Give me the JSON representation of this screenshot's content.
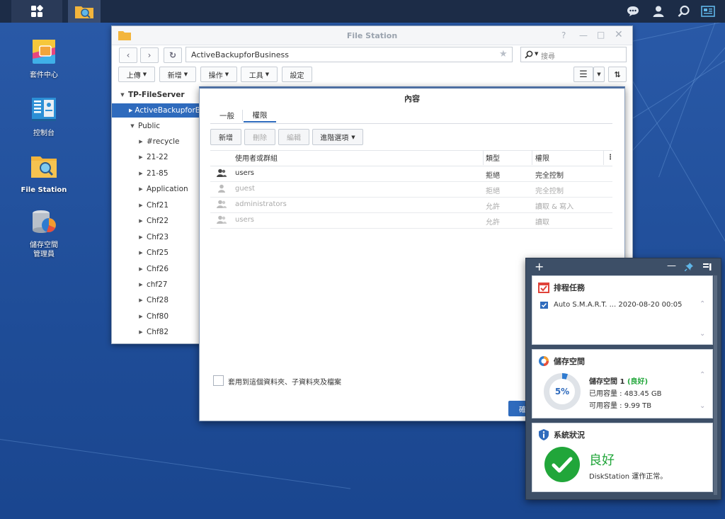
{
  "taskbar": {
    "icons": [
      "apps-grid-icon",
      "file-station-icon",
      "chat-icon",
      "user-icon",
      "search-icon",
      "widgets-icon"
    ]
  },
  "desktop": {
    "icons": [
      {
        "label": "套件中心"
      },
      {
        "label": "控制台"
      },
      {
        "label": "File Station"
      },
      {
        "label": "儲存空間\n管理員"
      }
    ]
  },
  "file_station": {
    "title": "File Station",
    "path": "ActiveBackupforBusiness",
    "search_placeholder": "搜尋",
    "toolbar": {
      "upload": "上傳",
      "create": "新增",
      "action": "操作",
      "tools": "工具",
      "settings": "設定"
    },
    "tree": {
      "root": "TP-FileServer",
      "items": [
        {
          "label": "ActiveBackupforBusiness",
          "level": 1,
          "selected": true
        },
        {
          "label": "Public",
          "level": 1,
          "expanded": true
        },
        {
          "label": "#recycle",
          "level": 2
        },
        {
          "label": "21-22",
          "level": 2
        },
        {
          "label": "21-85",
          "level": 2
        },
        {
          "label": "Application",
          "level": 2
        },
        {
          "label": "Chf21",
          "level": 2
        },
        {
          "label": "Chf22",
          "level": 2
        },
        {
          "label": "Chf23",
          "level": 2
        },
        {
          "label": "Chf25",
          "level": 2
        },
        {
          "label": "Chf26",
          "level": 2
        },
        {
          "label": "chf27",
          "level": 2
        },
        {
          "label": "Chf28",
          "level": 2
        },
        {
          "label": "Chf80",
          "level": 2
        },
        {
          "label": "Chf82",
          "level": 2
        }
      ]
    }
  },
  "properties": {
    "title": "內容",
    "tabs": [
      {
        "label": "一般"
      },
      {
        "label": "權限",
        "active": true
      }
    ],
    "buttons": {
      "add": "新增",
      "delete": "刪除",
      "edit": "編輯",
      "advanced": "進階選項"
    },
    "columns": {
      "name": "使用者或群組",
      "type": "類型",
      "permission": "權限"
    },
    "rows": [
      {
        "name": "users",
        "type": "拒絕",
        "permission": "完全控制",
        "enabled": true
      },
      {
        "name": "guest",
        "type": "拒絕",
        "permission": "完全控制",
        "enabled": false
      },
      {
        "name": "administrators",
        "type": "允許",
        "permission": "讀取 & 寫入",
        "enabled": false
      },
      {
        "name": "users",
        "type": "允許",
        "permission": "讀取",
        "enabled": false
      }
    ],
    "apply_label": "套用到這個資料夾、子資料夾及檔案",
    "ok_partial": "確"
  },
  "widgets": {
    "scheduled": {
      "title": "排程任務",
      "task": "Auto S.M.A.R.T. ... 2020-08-20 00:05"
    },
    "storage": {
      "title": "儲存空間",
      "percent": 5,
      "percent_label": "5%",
      "volume_name": "儲存空間 1",
      "volume_status": "(良好)",
      "used": "已用容量 : 483.45 GB",
      "available": "可用容量 : 9.99 TB"
    },
    "system": {
      "title": "系統狀況",
      "status": "良好",
      "detail": "DiskStation 運作正常。"
    }
  },
  "colors": {
    "taskbar": "#1c2c47",
    "accent": "#2f6bbd",
    "good_green": "#21a63a",
    "widget_panel": "#3d4f67"
  }
}
